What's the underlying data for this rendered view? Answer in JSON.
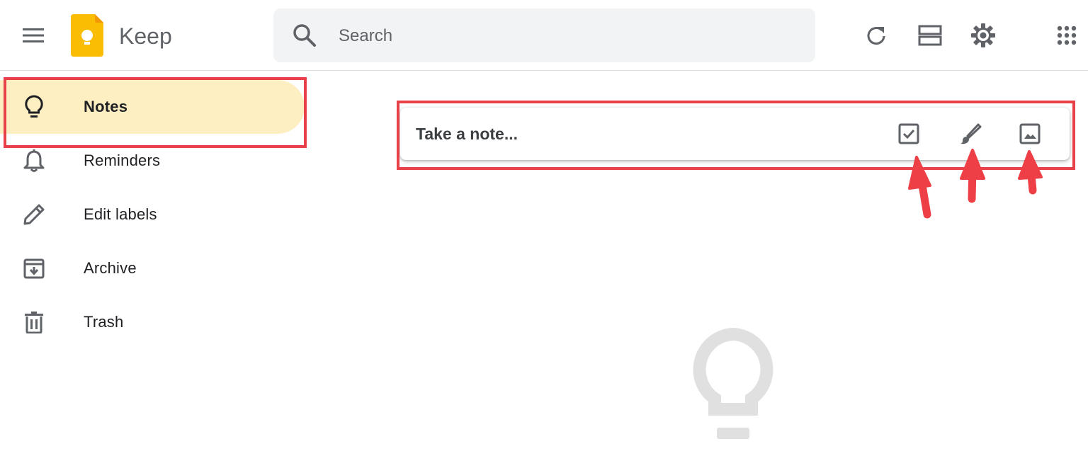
{
  "header": {
    "app_title": "Keep",
    "search_placeholder": "Search",
    "icons": {
      "menu": "hamburger-menu-icon",
      "search": "search-icon",
      "refresh": "refresh-icon",
      "layout": "list-view-icon",
      "settings": "gear-icon",
      "apps": "apps-grid-icon"
    }
  },
  "sidebar": {
    "items": [
      {
        "label": "Notes",
        "icon": "lightbulb-icon",
        "active": true
      },
      {
        "label": "Reminders",
        "icon": "bell-icon",
        "active": false
      },
      {
        "label": "Edit labels",
        "icon": "pencil-icon",
        "active": false
      },
      {
        "label": "Archive",
        "icon": "archive-icon",
        "active": false
      },
      {
        "label": "Trash",
        "icon": "trash-icon",
        "active": false
      }
    ]
  },
  "main": {
    "take_note_placeholder": "Take a note...",
    "tools": [
      "checkbox-icon",
      "brush-icon",
      "image-icon"
    ]
  },
  "colors": {
    "active_nav_bg": "#feefc3",
    "logo_yellow": "#fbbc04",
    "highlight_red": "#e8414a",
    "icon_gray": "#5f6368"
  }
}
